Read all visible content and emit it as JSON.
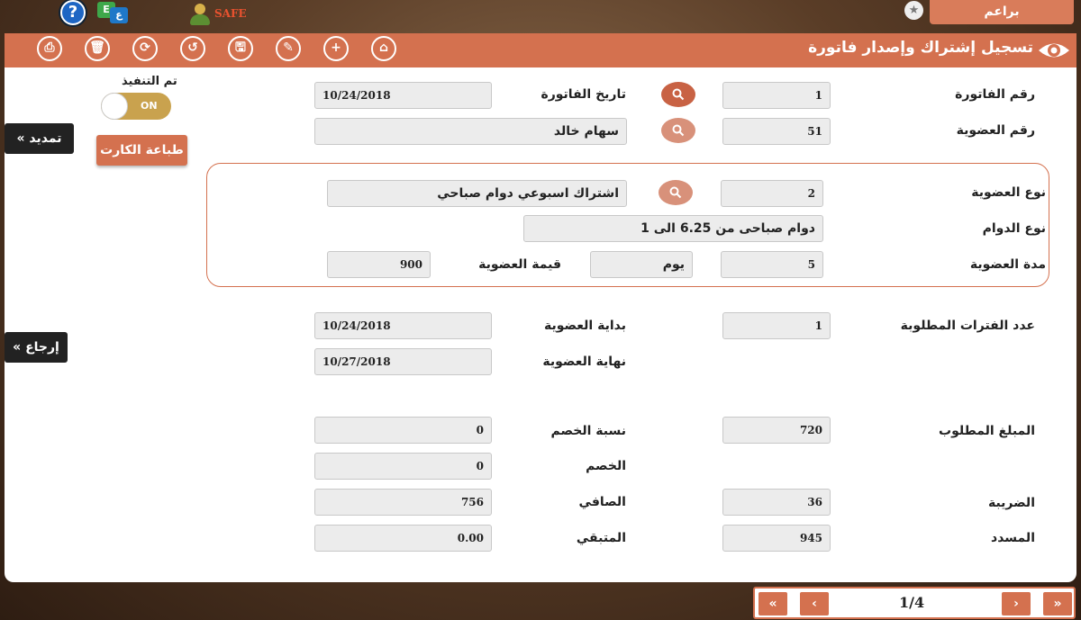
{
  "top": {
    "help_glyph": "?",
    "lang_glyph_en": "E",
    "lang_glyph_ar": "ع",
    "safe_label": "SAFE",
    "star_glyph": "★",
    "user_name": "براعم"
  },
  "header": {
    "title": "تسجيل إشتراك وإصدار فاتورة",
    "tools": [
      {
        "name": "home",
        "glyph": "⌂"
      },
      {
        "name": "add",
        "glyph": "+"
      },
      {
        "name": "edit",
        "glyph": "✎"
      },
      {
        "name": "save",
        "glyph": "🖫"
      },
      {
        "name": "undo",
        "glyph": "↺"
      },
      {
        "name": "refresh",
        "glyph": "⟳"
      },
      {
        "name": "delete",
        "glyph": "🗑"
      },
      {
        "name": "print",
        "glyph": "⎙"
      }
    ]
  },
  "side": {
    "exec_label": "تم التنفيذ",
    "toggle_label": "ON",
    "print_card": "طباعة الكارت",
    "extend": "« تمديد",
    "refund": "« إرجاع"
  },
  "form": {
    "invoice_no_label": "رقم الفاتورة",
    "invoice_no": "1",
    "invoice_date_label": "تاريخ الفاتورة",
    "invoice_date": "10/24/2018",
    "member_no_label": "رقم العضوية",
    "member_no": "51",
    "member_name": "سهام خالد",
    "member_type_label": "نوع العضوية",
    "member_type_code": "2",
    "member_type_name": "اشتراك اسبوعي دوام صباحي",
    "shift_type_label": "نوع الدوام",
    "shift_type": "دوام صباحى من 6.25 الى 1",
    "duration_label": "مدة العضوية",
    "duration": "5",
    "duration_unit": "يوم",
    "member_value_label": "قيمة العضوية",
    "member_value": "900",
    "periods_label": "عدد الفترات المطلوبة",
    "periods": "1",
    "start_label": "بداية العضوية",
    "start_date": "10/24/2018",
    "end_label": "نهاية العضوية",
    "end_date": "10/27/2018",
    "required_amount_label": "المبلغ المطلوب",
    "required_amount": "720",
    "discount_pct_label": "نسبة الخصم",
    "discount_pct": "0",
    "discount_label": "الخصم",
    "discount": "0",
    "tax_label": "الضريبة",
    "tax": "36",
    "net_label": "الصافي",
    "net": "756",
    "paid_label": "المسدد",
    "paid": "945",
    "remaining_label": "المتبقي",
    "remaining": "0.00"
  },
  "pager": {
    "first": "«",
    "prev": "‹",
    "text": "1/4",
    "next": "›",
    "last": "»"
  }
}
